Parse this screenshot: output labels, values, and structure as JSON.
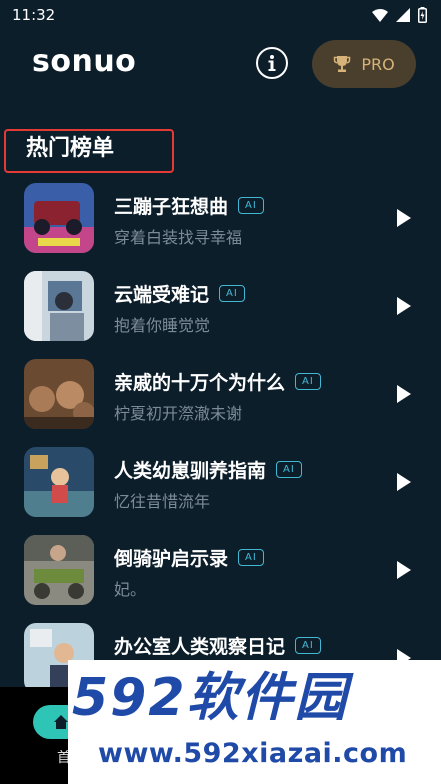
{
  "status_bar": {
    "time": "11:32"
  },
  "header": {
    "app_title": "sonuo",
    "pro_label": "PRO"
  },
  "section": {
    "title": "热门榜单"
  },
  "songs": [
    {
      "title": "三蹦子狂想曲",
      "badge": "AI",
      "subtitle": "穿着白装找寻幸福"
    },
    {
      "title": "云端受难记",
      "badge": "AI",
      "subtitle": "抱着你睡觉觉"
    },
    {
      "title": "亲戚的十万个为什么",
      "badge": "AI",
      "subtitle": "柠夏初开漈澈未谢"
    },
    {
      "title": "人类幼崽驯养指南",
      "badge": "AI",
      "subtitle": "忆往昔惜流年"
    },
    {
      "title": "倒骑驴启示录",
      "badge": "AI",
      "subtitle": "妃。"
    },
    {
      "title": "办公室人类观察日记",
      "badge": "AI",
      "subtitle": ""
    }
  ],
  "bottom_nav": {
    "home_label": "首"
  },
  "watermark": {
    "logo_text": "592软件园",
    "url": "www.592xiazai.com"
  },
  "icons": {
    "info": "info-icon",
    "pro": "trophy-icon",
    "play": "play-icon",
    "wifi": "wifi-icon",
    "signal": "signal-icon",
    "battery": "battery-icon"
  },
  "colors": {
    "background": "#0d1e2b",
    "pro_button": "#4a3f2c",
    "pro_text": "#d7b37a",
    "ai_badge": "#43b8d4",
    "subtitle": "#7b8b97",
    "highlight_box": "#e53935",
    "home_pill": "#2ec4b6",
    "watermark": "#1f4aa8"
  }
}
